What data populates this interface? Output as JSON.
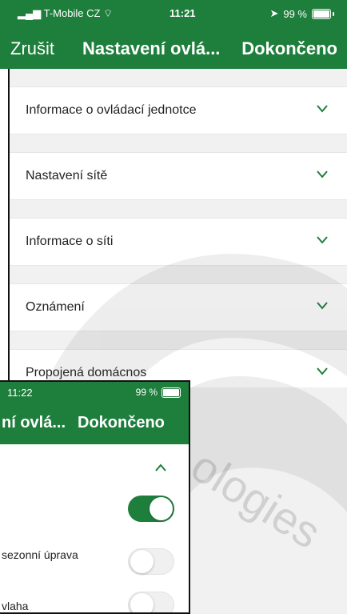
{
  "main": {
    "status_bar": {
      "carrier": "T-Mobile CZ",
      "time": "11:21",
      "battery": "99 %"
    },
    "header": {
      "cancel_label": "Zrušit",
      "title": "Nastavení ovlá...",
      "done_label": "Dokončeno"
    },
    "sections": [
      {
        "label": "Informace o ovládací jednotce"
      },
      {
        "label": "Nastavení sítě"
      },
      {
        "label": "Informace o síti"
      },
      {
        "label": "Oznámení"
      },
      {
        "label": "Propojená domácnos"
      }
    ]
  },
  "overlay": {
    "status_bar": {
      "time": "11:22",
      "battery": "99 %"
    },
    "header": {
      "title": "ní ovlá...",
      "done_label": "Dokončeno"
    },
    "rows": [
      {
        "label": "",
        "toggle_on": true
      },
      {
        "label": "sezonní úprava",
        "toggle_on": false
      },
      {
        "label": "vlaha",
        "toggle_on": false
      }
    ]
  },
  "colors": {
    "brand_green": "#1e7e3c",
    "background_gray": "#f1f1f1"
  },
  "watermark": {
    "text": "ologies"
  }
}
